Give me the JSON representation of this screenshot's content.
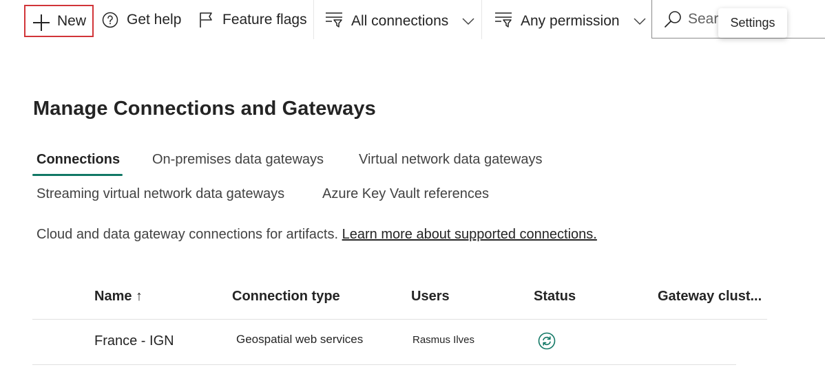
{
  "toolbar": {
    "new_label": "New",
    "help_label": "Get help",
    "flags_label": "Feature flags",
    "connections_filter": "All connections",
    "permission_filter": "Any permission",
    "search_placeholder": "Search",
    "tooltip": "Settings"
  },
  "page": {
    "title": "Manage Connections and Gateways",
    "tabs": [
      "Connections",
      "On-premises data gateways",
      "Virtual network data gateways",
      "Streaming virtual network data gateways",
      "Azure Key Vault references"
    ],
    "active_tab": "Connections",
    "description": "Cloud and data gateway connections for artifacts.",
    "learn_more_link": "Learn more about supported connections."
  },
  "table": {
    "columns": [
      "Name ↑",
      "Connection type",
      "Users",
      "Status",
      "Gateway clust..."
    ],
    "rows": [
      {
        "name": "France - IGN",
        "connection_type": "Geospatial web services",
        "users": "Rasmus Ilves",
        "status_icon": "sync-icon"
      }
    ]
  },
  "colors": {
    "accent": "#117865",
    "highlight_border": "#d13438",
    "text": "#242424"
  }
}
